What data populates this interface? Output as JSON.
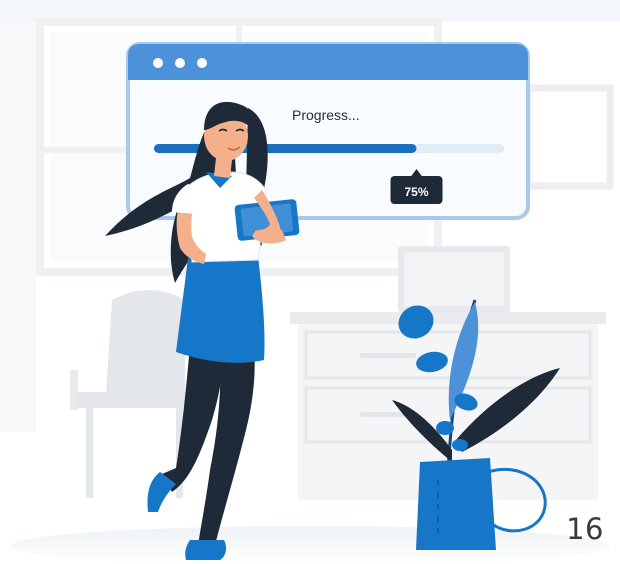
{
  "progress_window": {
    "title": "Progress...",
    "progress": 0.75,
    "percent_label": "75%"
  },
  "page": {
    "number": "16"
  },
  "colors": {
    "brand_blue": "#1677c8",
    "dark_navy": "#1f2a38",
    "light_gray": "#eef0f3"
  }
}
